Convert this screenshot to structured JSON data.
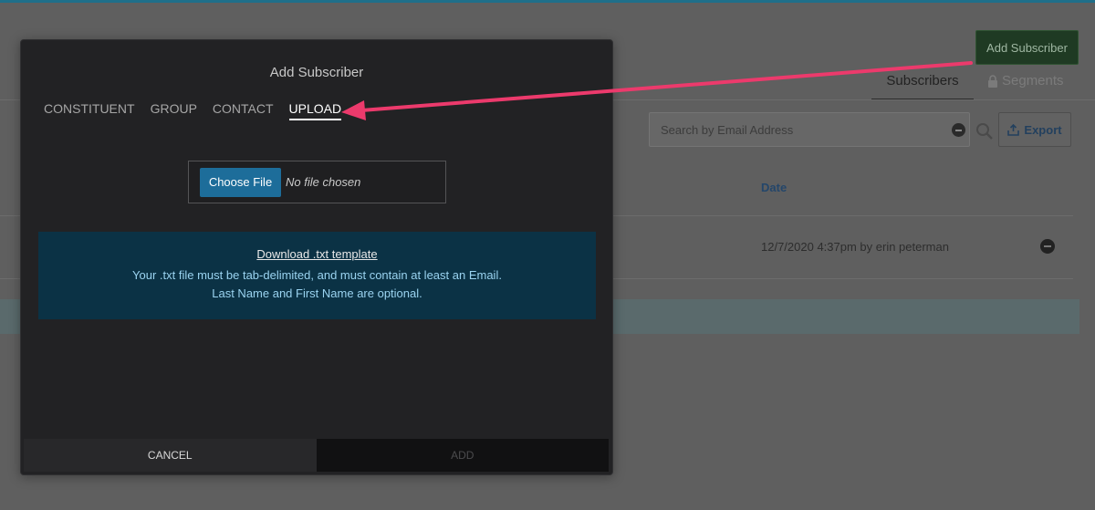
{
  "background": {
    "add_subscriber_label": "Add Subscriber",
    "tabs": [
      {
        "label": "Subscribers"
      },
      {
        "label": "Segments"
      }
    ],
    "search_placeholder": "Search by Email Address",
    "export_label": "Export",
    "table": {
      "date_header": "Date",
      "rows": [
        {
          "date": "12/7/2020 4:37pm by erin peterman"
        }
      ]
    }
  },
  "modal": {
    "title": "Add Subscriber",
    "tabs": [
      {
        "label": "CONSTITUENT",
        "active": false
      },
      {
        "label": "GROUP",
        "active": false
      },
      {
        "label": "CONTACT",
        "active": false
      },
      {
        "label": "UPLOAD",
        "active": true
      }
    ],
    "file_input": {
      "button_label": "Choose File",
      "status": "No file chosen"
    },
    "info": {
      "download_link": "Download .txt template",
      "line1": "Your .txt file must be tab-delimited, and must contain at least an Email.",
      "line2": "Last Name and First Name are optional."
    },
    "footer": {
      "cancel_label": "CANCEL",
      "add_label": "ADD"
    }
  },
  "colors": {
    "accent": "#1d6d9a",
    "annotation_arrow": "#ec3a6c",
    "info_bg": "#0b3245",
    "modal_bg": "#222224"
  }
}
